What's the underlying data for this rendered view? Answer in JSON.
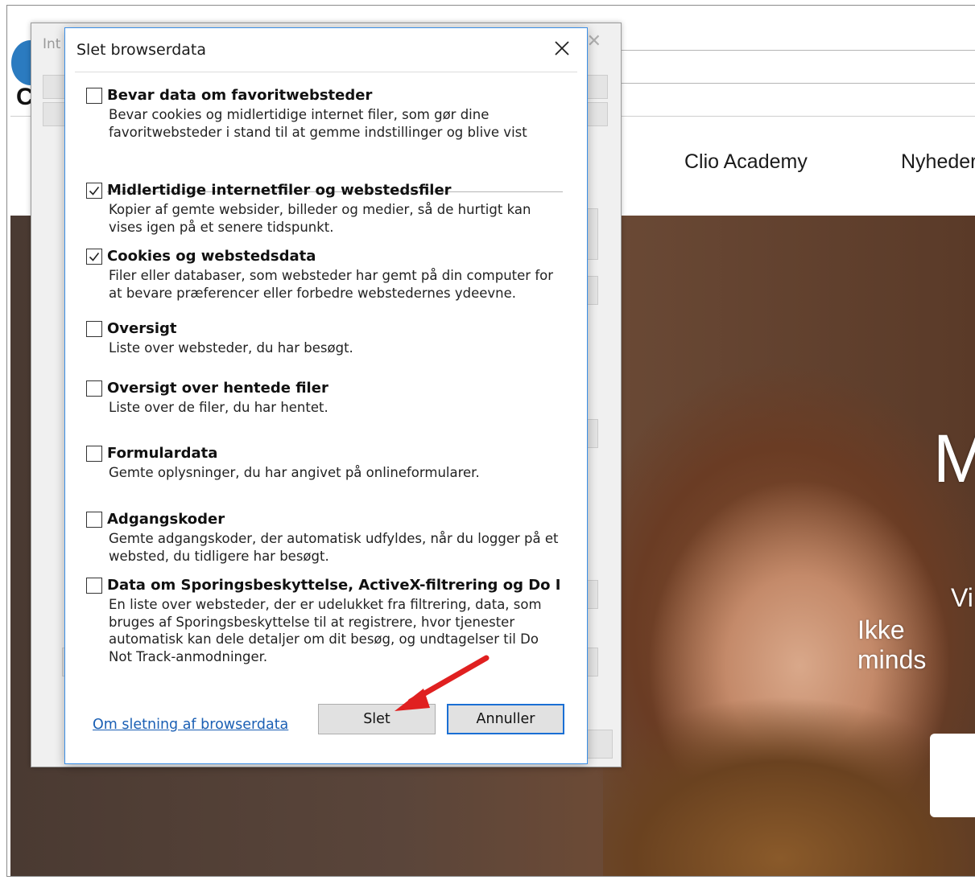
{
  "browser": {
    "bg_dialog_title": "Int",
    "bg_back_letter": "C",
    "nav_items": [
      "Clio Academy",
      "Nyheder"
    ],
    "hero_big_letter": "M",
    "hero_line1": "Vi",
    "hero_line2": "Ikke minds"
  },
  "dialog": {
    "title": "Slet browserdata",
    "options": [
      {
        "label": "Bevar data om favoritwebsteder",
        "checked": false,
        "description": "Bevar cookies og midlertidige internet filer, som gør dine favoritwebsteder i stand til at gemme indstillinger og blive vist"
      },
      {
        "label": "Midlertidige internetfiler og webstedsfiler",
        "checked": true,
        "description": "Kopier af gemte websider, billeder og medier, så de hurtigt kan vises igen på et senere tidspunkt."
      },
      {
        "label": "Cookies og webstedsdata",
        "checked": true,
        "description": "Filer eller databaser, som websteder har gemt på din computer for at bevare præferencer eller forbedre webstedernes ydeevne."
      },
      {
        "label": "Oversigt",
        "checked": false,
        "description": "Liste over websteder, du har besøgt."
      },
      {
        "label": "Oversigt over hentede filer",
        "checked": false,
        "description": "Liste over de filer, du har hentet."
      },
      {
        "label": "Formulardata",
        "checked": false,
        "description": "Gemte oplysninger, du har angivet på onlineformularer."
      },
      {
        "label": "Adgangskoder",
        "checked": false,
        "description": "Gemte adgangskoder, der automatisk udfyldes, når du logger på et websted, du tidligere har besøgt."
      },
      {
        "label": "Data om Sporingsbeskyttelse, ActiveX-filtrering og Do I",
        "checked": false,
        "description": "En liste over websteder, der er udelukket fra filtrering, data, som bruges af Sporingsbeskyttelse til at registrere, hvor tjenester automatisk kan dele detaljer om dit besøg, og undtagelser til Do Not Track-anmodninger."
      }
    ],
    "link_text": "Om sletning af browserdata",
    "delete_label": "Slet",
    "cancel_label": "Annuller"
  },
  "colors": {
    "accent_border": "#3a8ee6",
    "link": "#1a5fb4",
    "arrow": "#e02020"
  }
}
